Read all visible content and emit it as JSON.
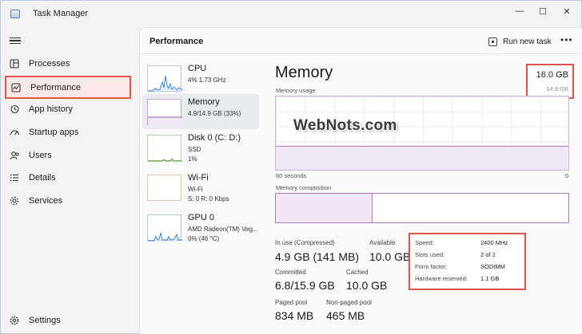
{
  "window": {
    "title": "Task Manager"
  },
  "controls": {
    "minimize": "—",
    "maximize": "☐",
    "close": "✕"
  },
  "sidebar": {
    "items": [
      {
        "label": "Processes",
        "icon": "processes-icon",
        "selected": false
      },
      {
        "label": "Performance",
        "icon": "performance-icon",
        "selected": true
      },
      {
        "label": "App history",
        "icon": "history-icon",
        "selected": false
      },
      {
        "label": "Startup apps",
        "icon": "startup-icon",
        "selected": false
      },
      {
        "label": "Users",
        "icon": "users-icon",
        "selected": false
      },
      {
        "label": "Details",
        "icon": "details-icon",
        "selected": false
      },
      {
        "label": "Services",
        "icon": "services-icon",
        "selected": false
      }
    ],
    "settings": "Settings"
  },
  "header": {
    "title": "Performance",
    "run_new_task": "Run new task",
    "more": "•••"
  },
  "devices": [
    {
      "name": "CPU",
      "line1": "4%  1.73 GHz"
    },
    {
      "name": "Memory",
      "line1": "4.9/14.9 GB (33%)"
    },
    {
      "name": "Disk 0 (C: D:)",
      "line1": "SSD",
      "line2": "1%"
    },
    {
      "name": "Wi-Fi",
      "line1": "Wi-Fi",
      "line2": "S: 0  R: 0 Kbps"
    },
    {
      "name": "GPU 0",
      "line1": "AMD Radeon(TM) Veg...",
      "line2": "0%  (46 °C)"
    }
  ],
  "memory": {
    "title": "Memory",
    "total": "16.0 GB",
    "usable": "14.9 GB",
    "usage_label": "Memory usage",
    "time_left": "60 seconds",
    "time_right": "0",
    "composition_label": "Memory composition",
    "in_use_fraction": 0.33,
    "stats": {
      "in_use_label": "In use (Compressed)",
      "in_use": "4.9 GB (141 MB)",
      "available_label": "Available",
      "available": "10.0 GB",
      "committed_label": "Committed",
      "committed": "6.8/15.9 GB",
      "cached_label": "Cached",
      "cached": "10.0 GB",
      "paged_label": "Paged pool",
      "paged": "834 MB",
      "nonpaged_label": "Non-paged pool",
      "nonpaged": "465 MB"
    },
    "specs": [
      {
        "label": "Speed:",
        "value": "2400 MHz"
      },
      {
        "label": "Slots used:",
        "value": "2 of 2"
      },
      {
        "label": "Form factor:",
        "value": "SODIMM"
      },
      {
        "label": "Hardware reserved:",
        "value": "1.1 GB"
      }
    ]
  },
  "watermark": "WebNots.com",
  "colors": {
    "accent": "#e0544a",
    "memory": "#9b59b6"
  }
}
